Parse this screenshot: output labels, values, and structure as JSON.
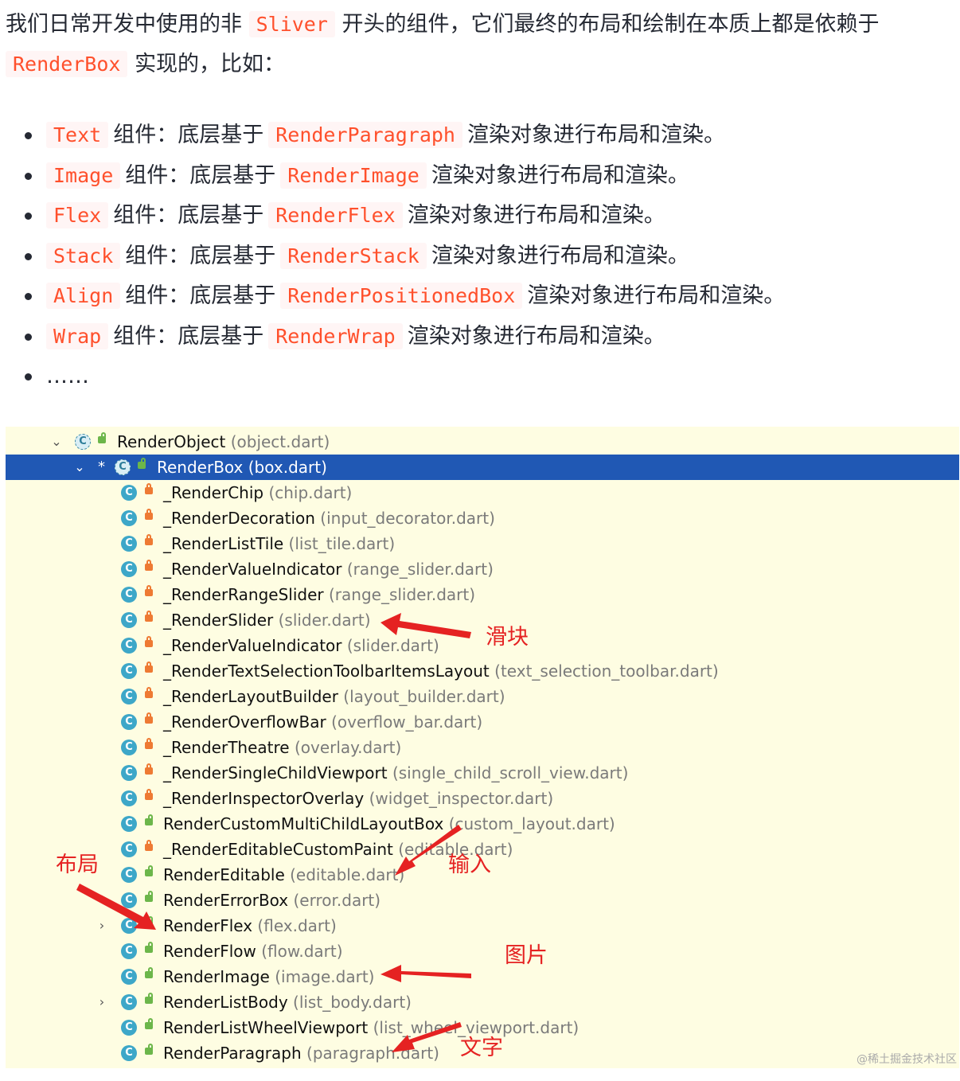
{
  "intro": {
    "part1": "我们日常开发中使用的非",
    "code1": "Sliver",
    "part2": "开头的组件，它们最终的布局和绘制在本质上都是依赖于",
    "code2": "RenderBox",
    "part3": "实现的，比如："
  },
  "bullets": [
    {
      "widget": "Text",
      "pre": "组件：底层基于",
      "render": "RenderParagraph",
      "post": "渲染对象进行布局和渲染。"
    },
    {
      "widget": "Image",
      "pre": "组件：底层基于",
      "render": "RenderImage",
      "post": "渲染对象进行布局和渲染。"
    },
    {
      "widget": "Flex",
      "pre": "组件：底层基于",
      "render": "RenderFlex",
      "post": "渲染对象进行布局和渲染。"
    },
    {
      "widget": "Stack",
      "pre": "组件：底层基于",
      "render": "RenderStack",
      "post": "渲染对象进行布局和渲染。"
    },
    {
      "widget": "Align",
      "pre": "组件：底层基于",
      "render": "RenderPositionedBox",
      "post": "渲染对象进行布局和渲染。"
    },
    {
      "widget": "Wrap",
      "pre": "组件：底层基于",
      "render": "RenderWrap",
      "post": "渲染对象进行布局和渲染。"
    }
  ],
  "ellipsis": "……",
  "tree": {
    "root": {
      "name": "RenderObject",
      "file": "(object.dart)"
    },
    "selected": {
      "marker": "*",
      "name": "RenderBox",
      "file": "(box.dart)"
    },
    "children": [
      {
        "name": "_RenderChip",
        "file": "(chip.dart)",
        "access": "private"
      },
      {
        "name": "_RenderDecoration",
        "file": "(input_decorator.dart)",
        "access": "private"
      },
      {
        "name": "_RenderListTile",
        "file": "(list_tile.dart)",
        "access": "private"
      },
      {
        "name": "_RenderValueIndicator",
        "file": "(range_slider.dart)",
        "access": "private"
      },
      {
        "name": "_RenderRangeSlider",
        "file": "(range_slider.dart)",
        "access": "private"
      },
      {
        "name": "_RenderSlider",
        "file": "(slider.dart)",
        "access": "private"
      },
      {
        "name": "_RenderValueIndicator",
        "file": "(slider.dart)",
        "access": "private"
      },
      {
        "name": "_RenderTextSelectionToolbarItemsLayout",
        "file": "(text_selection_toolbar.dart)",
        "access": "private"
      },
      {
        "name": "_RenderLayoutBuilder",
        "file": "(layout_builder.dart)",
        "access": "private"
      },
      {
        "name": "_RenderOverflowBar",
        "file": "(overflow_bar.dart)",
        "access": "private"
      },
      {
        "name": "_RenderTheatre",
        "file": "(overlay.dart)",
        "access": "private"
      },
      {
        "name": "_RenderSingleChildViewport",
        "file": "(single_child_scroll_view.dart)",
        "access": "private"
      },
      {
        "name": "_RenderInspectorOverlay",
        "file": "(widget_inspector.dart)",
        "access": "private"
      },
      {
        "name": "RenderCustomMultiChildLayoutBox",
        "file": "(custom_layout.dart)",
        "access": "public"
      },
      {
        "name": "_RenderEditableCustomPaint",
        "file": "(editable.dart)",
        "access": "private"
      },
      {
        "name": "RenderEditable",
        "file": "(editable.dart)",
        "access": "public"
      },
      {
        "name": "RenderErrorBox",
        "file": "(error.dart)",
        "access": "public"
      },
      {
        "name": "RenderFlex",
        "file": "(flex.dart)",
        "access": "public",
        "expandable": true
      },
      {
        "name": "RenderFlow",
        "file": "(flow.dart)",
        "access": "public"
      },
      {
        "name": "RenderImage",
        "file": "(image.dart)",
        "access": "public"
      },
      {
        "name": "RenderListBody",
        "file": "(list_body.dart)",
        "access": "public",
        "expandable": true
      },
      {
        "name": "RenderListWheelViewport",
        "file": "(list_wheel_viewport.dart)",
        "access": "public"
      },
      {
        "name": "RenderParagraph",
        "file": "(paragraph.dart)",
        "access": "public"
      }
    ]
  },
  "annotations": {
    "slider": "滑块",
    "layout": "布局",
    "input": "输入",
    "image": "图片",
    "text": "文字"
  },
  "watermark": "@稀土掘金技术社区",
  "colors": {
    "code": "#ff502c",
    "code_bg": "#fff5f5",
    "tree_bg": "#fefde2",
    "selected": "#2058b4",
    "annotation": "#e52222"
  }
}
